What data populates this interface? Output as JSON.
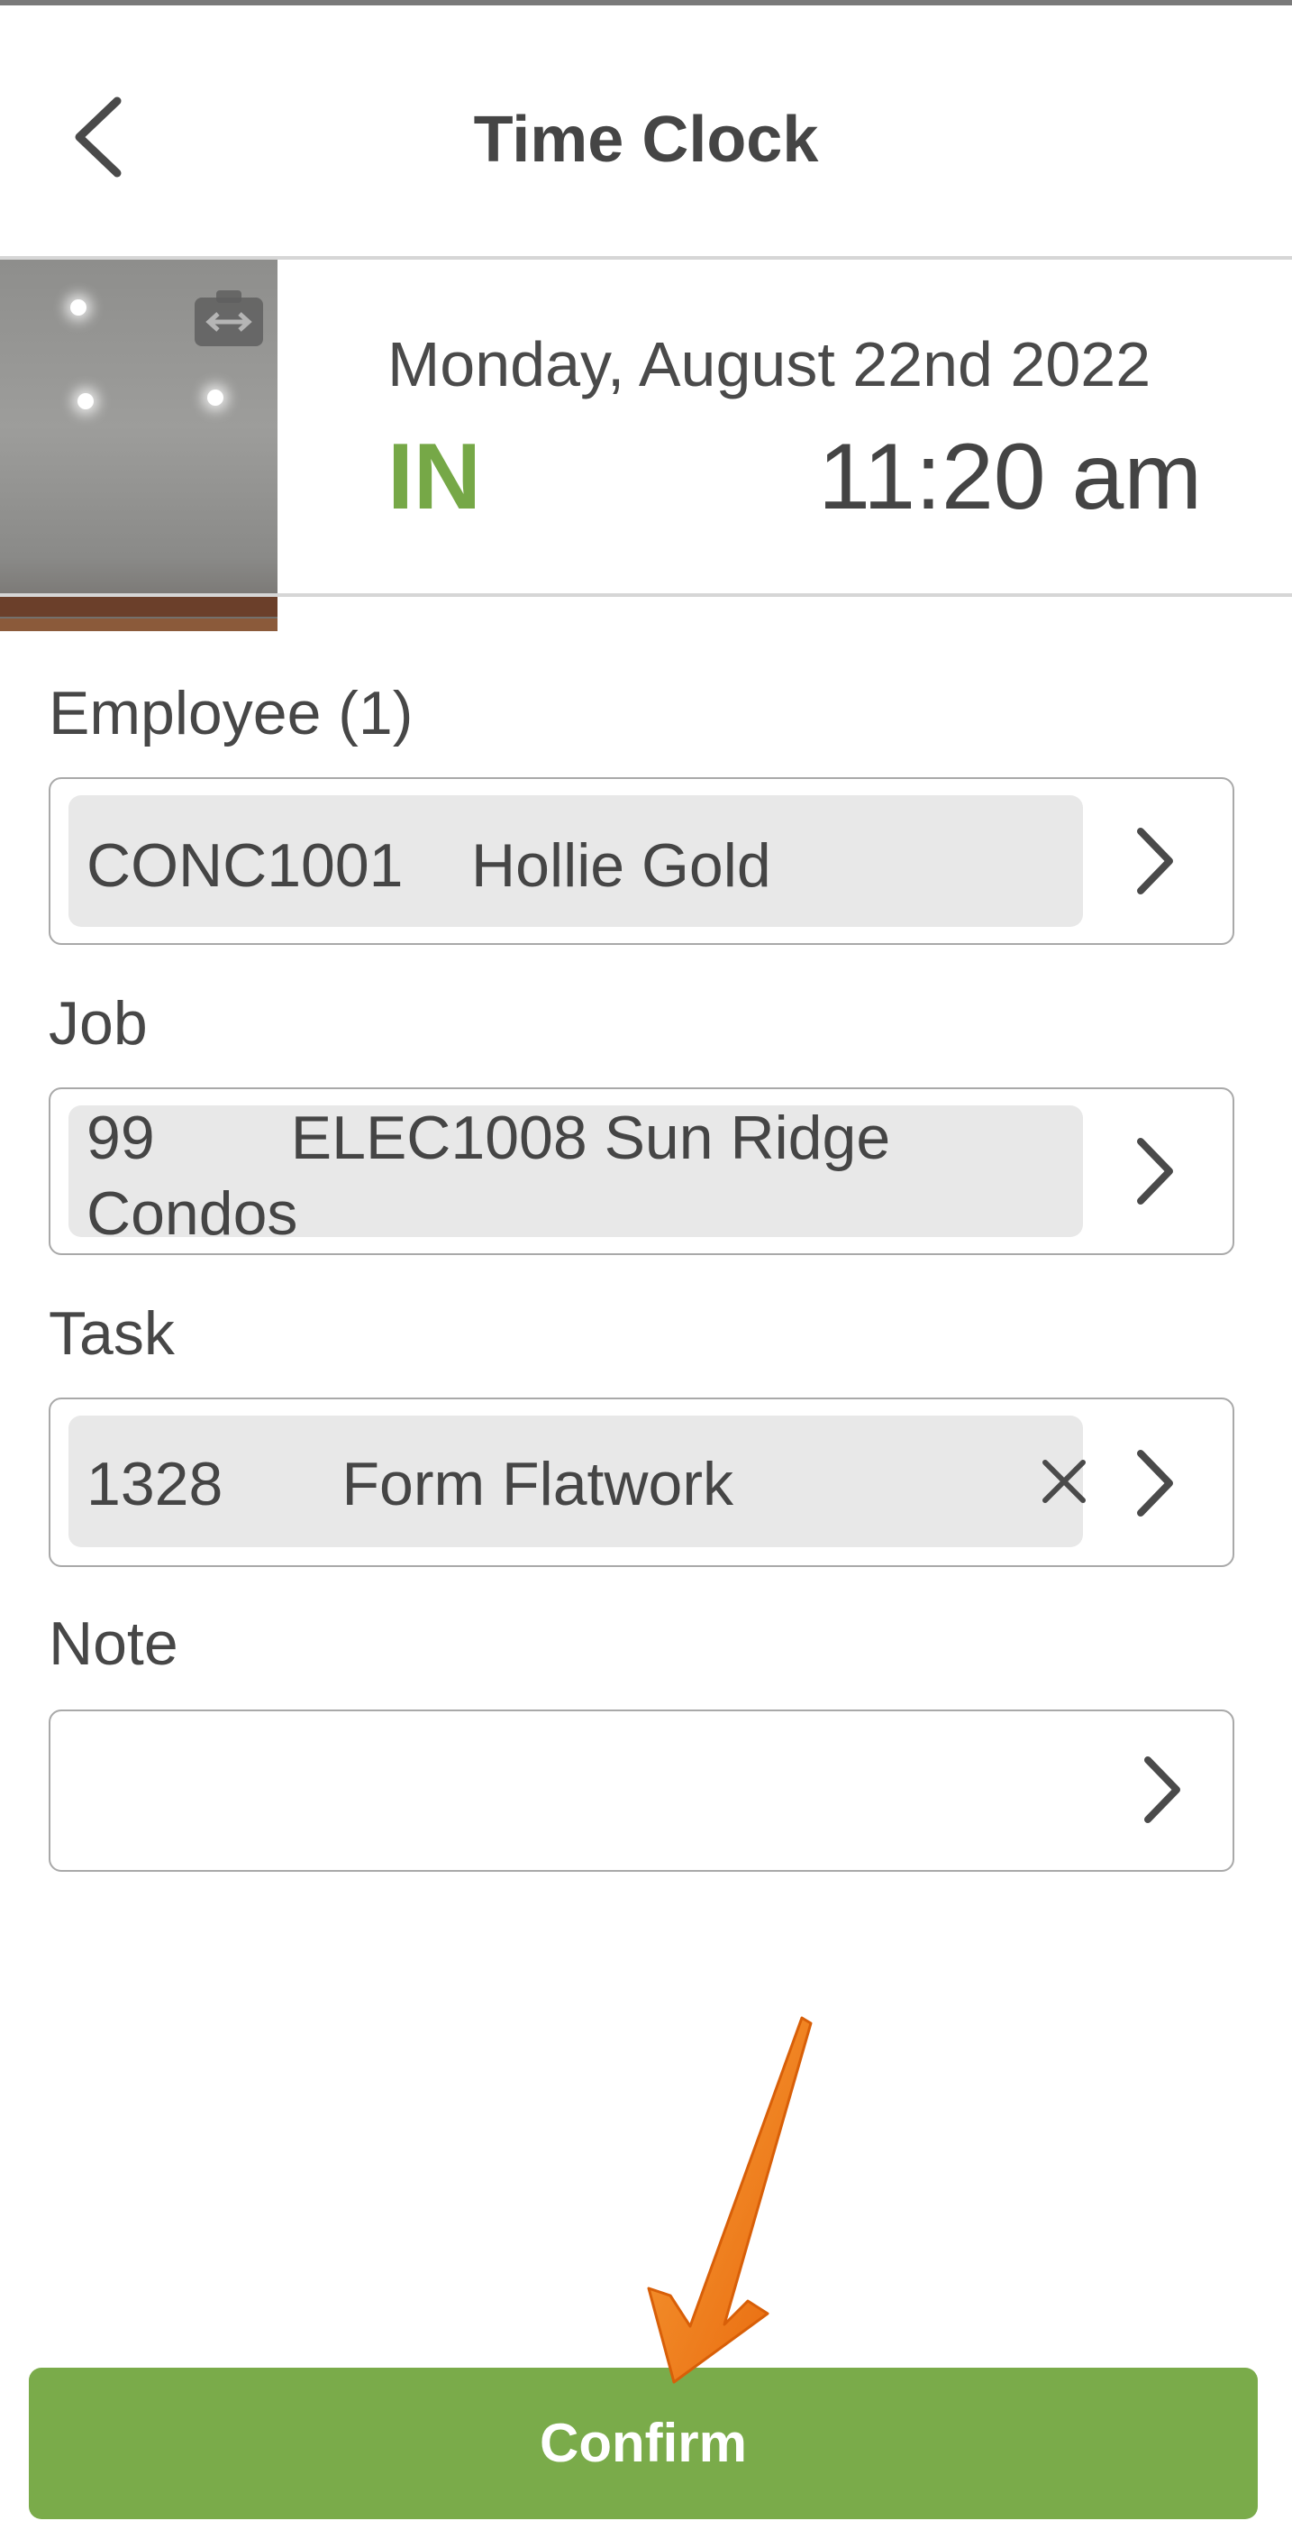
{
  "header": {
    "title": "Time Clock"
  },
  "summary": {
    "date": "Monday, August 22nd 2022",
    "status": "IN",
    "time": "11:20 am"
  },
  "form": {
    "employee": {
      "label": "Employee (1)",
      "value": "CONC1001    Hollie Gold"
    },
    "job": {
      "label": "Job",
      "value_line1": "99        ELEC1008 Sun Ridge",
      "value_line2": "Condos"
    },
    "task": {
      "label": "Task",
      "value": "1328       Form Flatwork"
    },
    "note": {
      "label": "Note",
      "value": ""
    }
  },
  "actions": {
    "confirm_label": "Confirm"
  },
  "colors": {
    "accent_green": "#7aab4a",
    "status_green": "#76a847",
    "annotation_orange": "#f07a10"
  },
  "icons": [
    "back-arrow-icon",
    "camera-switch-icon",
    "chevron-right-icon",
    "clear-x-icon",
    "annotation-arrow-icon"
  ]
}
